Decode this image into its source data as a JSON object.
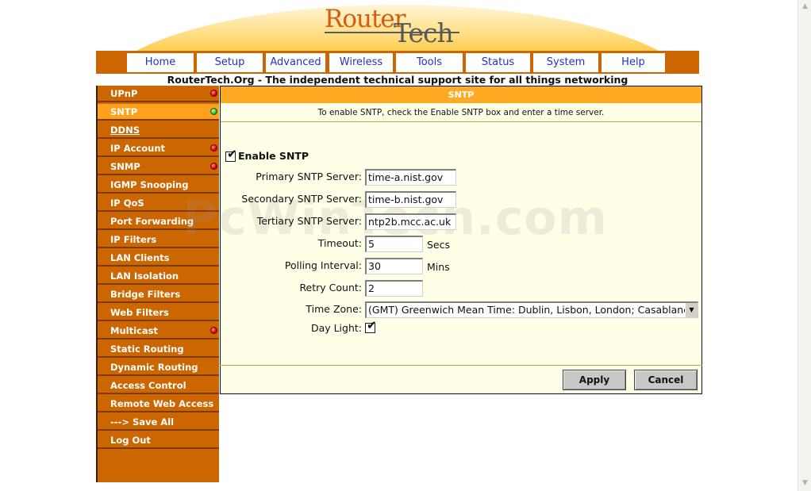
{
  "brand": {
    "logo_top": "Router",
    "logo_bottom": "Tech",
    "tagline": "RouterTech.Org - The independent technical support site for all things networking"
  },
  "nav": {
    "items": [
      "Home",
      "Setup",
      "Advanced",
      "Wireless",
      "Tools",
      "Status",
      "System",
      "Help"
    ]
  },
  "sidebar": {
    "items": [
      {
        "label": "UPnP",
        "status": "red"
      },
      {
        "label": "SNTP",
        "status": "green",
        "active": true
      },
      {
        "label": "DDNS",
        "link": true
      },
      {
        "label": "IP Account",
        "status": "red"
      },
      {
        "label": "SNMP",
        "status": "red"
      },
      {
        "label": "IGMP Snooping"
      },
      {
        "label": "IP QoS"
      },
      {
        "label": "Port Forwarding"
      },
      {
        "label": "IP Filters"
      },
      {
        "label": "LAN Clients"
      },
      {
        "label": "LAN Isolation"
      },
      {
        "label": "Bridge Filters"
      },
      {
        "label": "Web Filters"
      },
      {
        "label": "Multicast",
        "status": "red"
      },
      {
        "label": "Static Routing"
      },
      {
        "label": "Dynamic Routing"
      },
      {
        "label": "Access Control"
      },
      {
        "label": "Remote Web Access"
      },
      {
        "label": "---> Save All"
      },
      {
        "label": "Log Out"
      }
    ]
  },
  "panel": {
    "title": "SNTP",
    "hint": "To enable SNTP, check the Enable SNTP box and enter a time server."
  },
  "form": {
    "enable_label": "Enable SNTP",
    "enable_checked": true,
    "primary_label": "Primary SNTP Server:",
    "primary_value": "time-a.nist.gov",
    "secondary_label": "Secondary SNTP Server:",
    "secondary_value": "time-b.nist.gov",
    "tertiary_label": "Tertiary SNTP Server:",
    "tertiary_value": "ntp2b.mcc.ac.uk",
    "timeout_label": "Timeout:",
    "timeout_value": "5",
    "timeout_unit": "Secs",
    "polling_label": "Polling Interval:",
    "polling_value": "30",
    "polling_unit": "Mins",
    "retry_label": "Retry Count:",
    "retry_value": "2",
    "timezone_label": "Time Zone:",
    "timezone_value": "(GMT) Greenwich Mean Time: Dublin, Lisbon, London; Casablanca",
    "daylight_label": "Day Light:",
    "daylight_checked": true
  },
  "buttons": {
    "apply": "Apply",
    "cancel": "Cancel"
  },
  "watermark": "PcWinTech.com",
  "colors": {
    "orange": "#cc6600",
    "panel_head": "#ffaa22",
    "panel_bg": "#ffffe7",
    "nav_link": "#1b35c8"
  }
}
